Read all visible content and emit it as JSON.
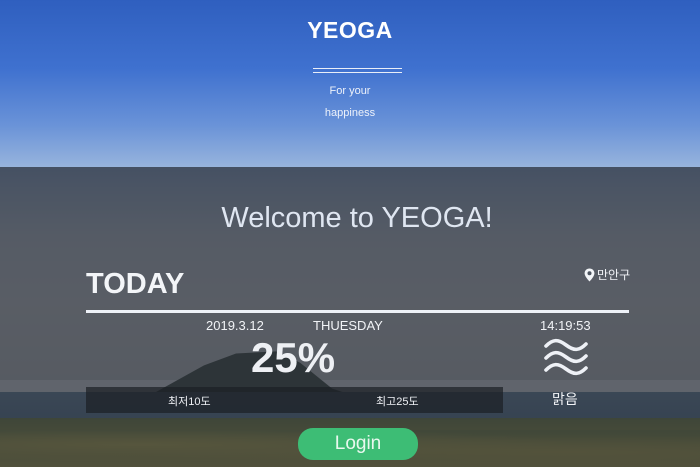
{
  "header": {
    "brand": "YEOGA",
    "tagline_line1": "For your",
    "tagline_line2": "happiness"
  },
  "main": {
    "welcome": "Welcome to YEOGA!",
    "today_label": "TODAY",
    "location": "만안구",
    "date": "2019.3.12",
    "day": "THUESDAY",
    "time": "14:19:53",
    "percent": "25%",
    "min_temp": "최저10도",
    "max_temp": "최고25도",
    "condition": "맑음",
    "condition_icon": "wind-waves-icon",
    "location_icon": "map-pin-icon"
  },
  "login": {
    "label": "Login"
  },
  "colors": {
    "accent": "#3dbd75",
    "sky_top": "#2f5fbf",
    "overlay": "#282e38",
    "text_light": "#dfe6f1"
  }
}
